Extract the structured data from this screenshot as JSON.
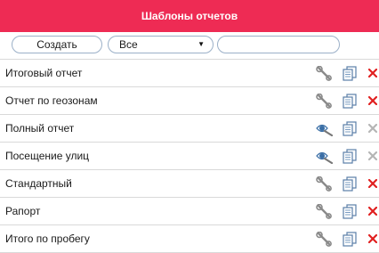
{
  "header": {
    "title": "Шаблоны отчетов"
  },
  "toolbar": {
    "create_label": "Создать",
    "filter_value": "Все",
    "search_value": "",
    "search_placeholder": ""
  },
  "colors": {
    "header_bg": "#ee2b54",
    "delete_active": "#e02020",
    "delete_disabled": "#b5b5b5"
  },
  "templates": [
    {
      "name": "Итоговый отчет",
      "action_icon": "wrench-icon",
      "delete_enabled": true
    },
    {
      "name": "Отчет по геозонам",
      "action_icon": "wrench-icon",
      "delete_enabled": true
    },
    {
      "name": "Полный отчет",
      "action_icon": "eye-icon",
      "delete_enabled": false
    },
    {
      "name": "Посещение улиц",
      "action_icon": "eye-icon",
      "delete_enabled": false
    },
    {
      "name": "Стандартный",
      "action_icon": "wrench-icon",
      "delete_enabled": true
    },
    {
      "name": "Рапорт",
      "action_icon": "wrench-icon",
      "delete_enabled": true
    },
    {
      "name": "Итого по пробегу",
      "action_icon": "wrench-icon",
      "delete_enabled": true
    }
  ]
}
